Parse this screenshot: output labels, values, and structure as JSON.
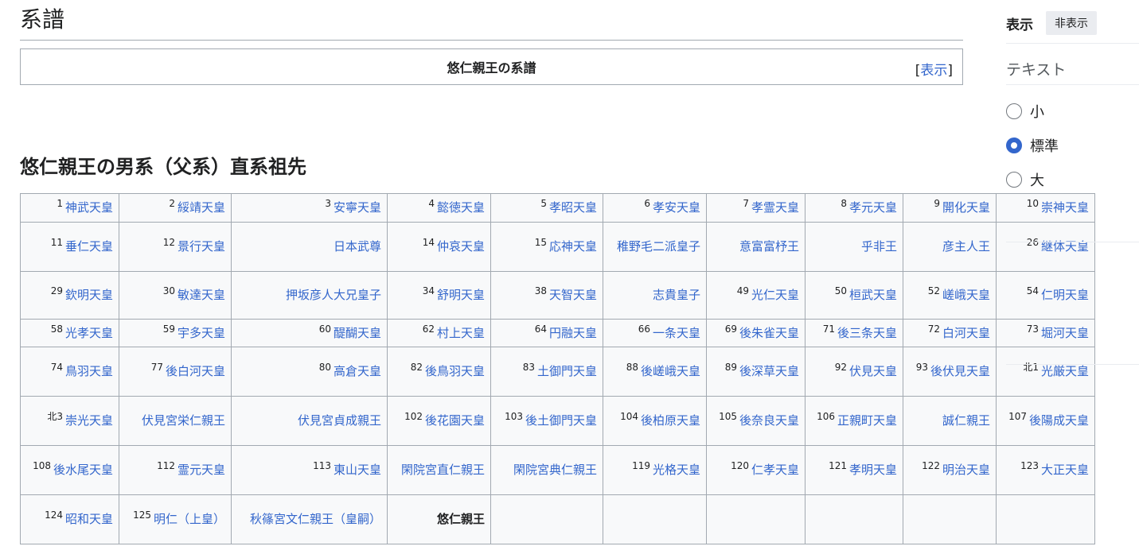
{
  "section": {
    "title": "系譜"
  },
  "navbox": {
    "title": "悠仁親王の系譜",
    "toggle_open": "[",
    "toggle_label": "表示",
    "toggle_close": "]"
  },
  "subheading": "悠仁親王の男系（父系）直系祖先",
  "lineage_rows": [
    [
      {
        "num": "1",
        "name": "神武天皇"
      },
      {
        "num": "2",
        "name": "綏靖天皇"
      },
      {
        "num": "3",
        "name": "安寧天皇"
      },
      {
        "num": "4",
        "name": "懿徳天皇"
      },
      {
        "num": "5",
        "name": "孝昭天皇"
      },
      {
        "num": "6",
        "name": "孝安天皇"
      },
      {
        "num": "7",
        "name": "孝霊天皇"
      },
      {
        "num": "8",
        "name": "孝元天皇"
      },
      {
        "num": "9",
        "name": "開化天皇"
      },
      {
        "num": "10",
        "name": "崇神天皇"
      }
    ],
    [
      {
        "num": "11",
        "name": "垂仁天皇"
      },
      {
        "num": "12",
        "name": "景行天皇"
      },
      {
        "num": "",
        "name": "日本武尊"
      },
      {
        "num": "14",
        "name": "仲哀天皇"
      },
      {
        "num": "15",
        "name": "応神天皇"
      },
      {
        "num": "",
        "name": "稚野毛二派皇子"
      },
      {
        "num": "",
        "name": "意富富杼王"
      },
      {
        "num": "",
        "name": "乎非王"
      },
      {
        "num": "",
        "name": "彦主人王"
      },
      {
        "num": "26",
        "name": "継体天皇"
      }
    ],
    [
      {
        "num": "29",
        "name": "欽明天皇"
      },
      {
        "num": "30",
        "name": "敏達天皇"
      },
      {
        "num": "",
        "name": "押坂彦人大兄皇子"
      },
      {
        "num": "34",
        "name": "舒明天皇"
      },
      {
        "num": "38",
        "name": "天智天皇"
      },
      {
        "num": "",
        "name": "志貴皇子"
      },
      {
        "num": "49",
        "name": "光仁天皇"
      },
      {
        "num": "50",
        "name": "桓武天皇"
      },
      {
        "num": "52",
        "name": "嵯峨天皇"
      },
      {
        "num": "54",
        "name": "仁明天皇"
      }
    ],
    [
      {
        "num": "58",
        "name": "光孝天皇"
      },
      {
        "num": "59",
        "name": "宇多天皇"
      },
      {
        "num": "60",
        "name": "醍醐天皇"
      },
      {
        "num": "62",
        "name": "村上天皇"
      },
      {
        "num": "64",
        "name": "円融天皇"
      },
      {
        "num": "66",
        "name": "一条天皇"
      },
      {
        "num": "69",
        "name": "後朱雀天皇"
      },
      {
        "num": "71",
        "name": "後三条天皇"
      },
      {
        "num": "72",
        "name": "白河天皇"
      },
      {
        "num": "73",
        "name": "堀河天皇"
      }
    ],
    [
      {
        "num": "74",
        "name": "鳥羽天皇"
      },
      {
        "num": "77",
        "name": "後白河天皇"
      },
      {
        "num": "80",
        "name": "高倉天皇"
      },
      {
        "num": "82",
        "name": "後鳥羽天皇"
      },
      {
        "num": "83",
        "name": "土御門天皇"
      },
      {
        "num": "88",
        "name": "後嵯峨天皇"
      },
      {
        "num": "89",
        "name": "後深草天皇"
      },
      {
        "num": "92",
        "name": "伏見天皇"
      },
      {
        "num": "93",
        "name": "後伏見天皇"
      },
      {
        "num": "北1",
        "name": "光厳天皇"
      }
    ],
    [
      {
        "num": "北3",
        "name": "崇光天皇"
      },
      {
        "num": "",
        "name": "伏見宮栄仁親王"
      },
      {
        "num": "",
        "name": "伏見宮貞成親王"
      },
      {
        "num": "102",
        "name": "後花園天皇"
      },
      {
        "num": "103",
        "name": "後土御門天皇"
      },
      {
        "num": "104",
        "name": "後柏原天皇"
      },
      {
        "num": "105",
        "name": "後奈良天皇"
      },
      {
        "num": "106",
        "name": "正親町天皇"
      },
      {
        "num": "",
        "name": "誠仁親王"
      },
      {
        "num": "107",
        "name": "後陽成天皇"
      }
    ],
    [
      {
        "num": "108",
        "name": "後水尾天皇"
      },
      {
        "num": "112",
        "name": "霊元天皇"
      },
      {
        "num": "113",
        "name": "東山天皇"
      },
      {
        "num": "",
        "name": "閑院宮直仁親王"
      },
      {
        "num": "",
        "name": "閑院宮典仁親王"
      },
      {
        "num": "119",
        "name": "光格天皇"
      },
      {
        "num": "120",
        "name": "仁孝天皇"
      },
      {
        "num": "121",
        "name": "孝明天皇"
      },
      {
        "num": "122",
        "name": "明治天皇"
      },
      {
        "num": "123",
        "name": "大正天皇"
      }
    ],
    [
      {
        "num": "124",
        "name": "昭和天皇"
      },
      {
        "num": "125",
        "name": "明仁（上皇）"
      },
      {
        "num": "",
        "name": "秋篠宮文仁親王（皇嗣）"
      },
      {
        "num": "",
        "name": "悠仁親王",
        "self": true
      },
      {
        "num": "",
        "name": ""
      },
      {
        "num": "",
        "name": ""
      },
      {
        "num": "",
        "name": ""
      },
      {
        "num": "",
        "name": ""
      },
      {
        "num": "",
        "name": ""
      },
      {
        "num": "",
        "name": ""
      }
    ]
  ],
  "sidebar": {
    "title": "表示",
    "hide_button": "非表示",
    "text_label": "テキスト",
    "options": [
      {
        "label": "小",
        "checked": false
      },
      {
        "label": "標準",
        "checked": true
      },
      {
        "label": "大",
        "checked": false
      }
    ]
  },
  "colors": {
    "link": "#3366cc",
    "border": "#a2a9b1",
    "cell_bg": "#f8f9fa"
  }
}
